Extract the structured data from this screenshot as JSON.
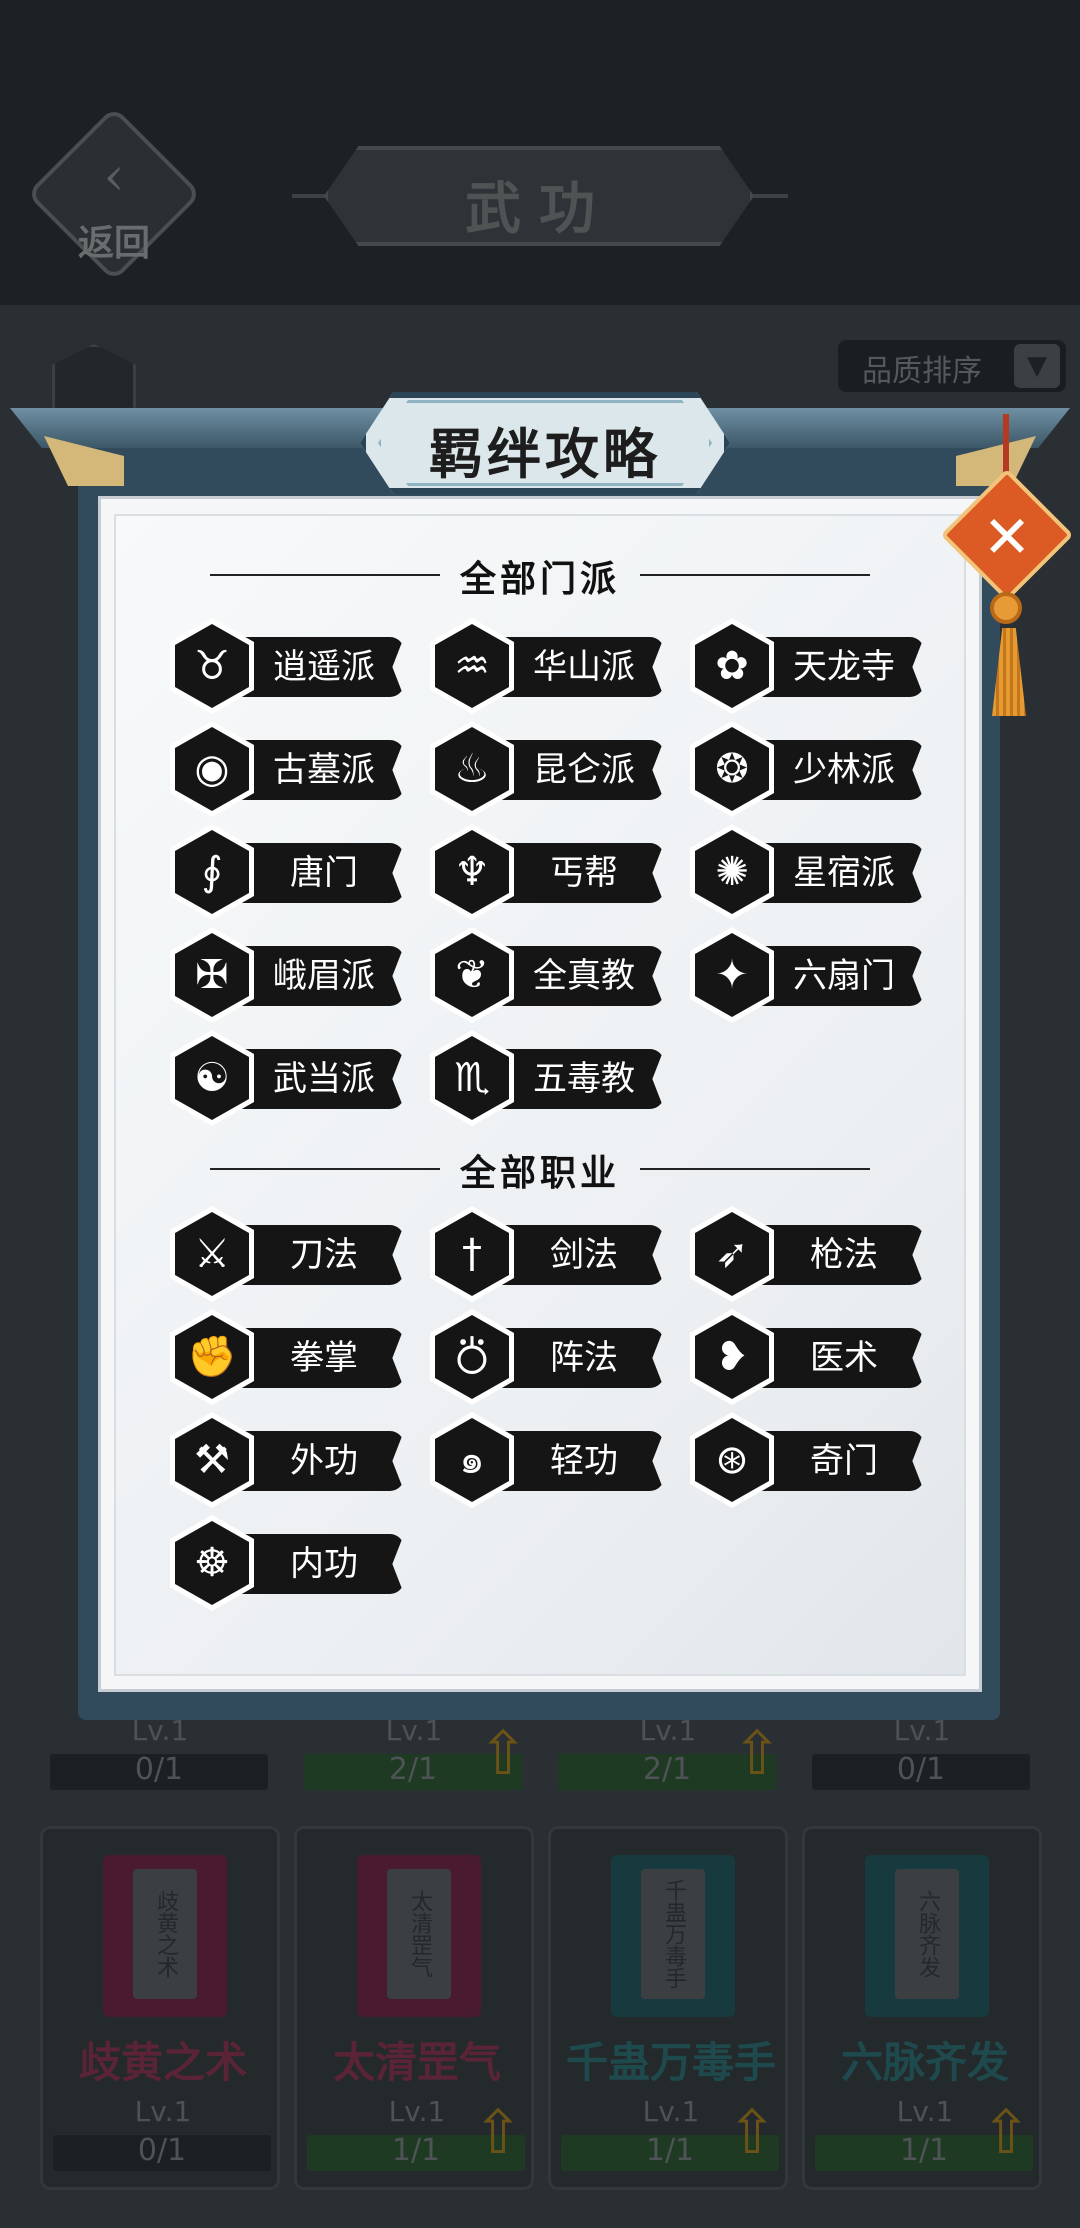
{
  "header": {
    "back_label": "返回",
    "title": "武功"
  },
  "sort": {
    "label": "品质排序"
  },
  "bg_cards": [
    {
      "name": "歧黄之术",
      "seal": "歧黄之术",
      "lv": "Lv.1",
      "progress": "0/1",
      "color": "#5a2436",
      "book": "#4a1b2e"
    },
    {
      "name": "太清罡气",
      "seal": "太清罡气",
      "lv": "Lv.1",
      "progress": "1/1",
      "color": "#5a2436",
      "book": "#4a1b2e"
    },
    {
      "name": "千蛊万毒手",
      "seal": "千蛊万毒手",
      "lv": "Lv.1",
      "progress": "1/1",
      "color": "#1f4a4d",
      "book": "#163a3d"
    },
    {
      "name": "六脉齐发",
      "seal": "六脉齐发",
      "lv": "Lv.1",
      "progress": "1/1",
      "color": "#1f4a4d",
      "book": "#163a3d"
    }
  ],
  "bg_row2": [
    {
      "lv": "Lv.1",
      "progress": "0/1"
    },
    {
      "lv": "Lv.1",
      "progress": "2/1"
    },
    {
      "lv": "Lv.1",
      "progress": "2/1"
    },
    {
      "lv": "Lv.1",
      "progress": "0/1"
    }
  ],
  "modal": {
    "title": "羁绊攻略",
    "close_icon": "close-x-icon",
    "sections": {
      "sects_title": "全部门派",
      "jobs_title": "全部职业"
    },
    "sects": [
      {
        "label": "逍遥派",
        "icon": "gourd-icon",
        "glyph": "♉"
      },
      {
        "label": "华山派",
        "icon": "dragon-wave-icon",
        "glyph": "♒"
      },
      {
        "label": "天龙寺",
        "icon": "lotus-icon",
        "glyph": "✿"
      },
      {
        "label": "古墓派",
        "icon": "eye-icon",
        "glyph": "◉"
      },
      {
        "label": "昆仑派",
        "icon": "flame-mask-icon",
        "glyph": "♨"
      },
      {
        "label": "少林派",
        "icon": "prayer-beads-icon",
        "glyph": "❂"
      },
      {
        "label": "唐门",
        "icon": "phoenix-icon",
        "glyph": "∮"
      },
      {
        "label": "丐帮",
        "icon": "claw-icon",
        "glyph": "♆"
      },
      {
        "label": "星宿派",
        "icon": "star-swirl-icon",
        "glyph": "✺"
      },
      {
        "label": "峨眉派",
        "icon": "sword-cross-icon",
        "glyph": "✠"
      },
      {
        "label": "全真教",
        "icon": "wing-icon",
        "glyph": "❦"
      },
      {
        "label": "六扇门",
        "icon": "compass-star-icon",
        "glyph": "✦"
      },
      {
        "label": "武当派",
        "icon": "yin-yang-icon",
        "glyph": "☯"
      },
      {
        "label": "五毒教",
        "icon": "scorpion-icon",
        "glyph": "♏"
      }
    ],
    "jobs": [
      {
        "label": "刀法",
        "icon": "crossed-blades-icon",
        "glyph": "⚔"
      },
      {
        "label": "剑法",
        "icon": "sword-icon",
        "glyph": "†"
      },
      {
        "label": "枪法",
        "icon": "spear-icon",
        "glyph": "➶"
      },
      {
        "label": "拳掌",
        "icon": "fist-icon",
        "glyph": "✊"
      },
      {
        "label": "阵法",
        "icon": "triquetra-icon",
        "glyph": "⛣"
      },
      {
        "label": "医术",
        "icon": "heart-herb-icon",
        "glyph": "❥"
      },
      {
        "label": "外功",
        "icon": "axe-icon",
        "glyph": "⚒"
      },
      {
        "label": "轻功",
        "icon": "swirl-wind-icon",
        "glyph": "๑"
      },
      {
        "label": "奇门",
        "icon": "orb-icon",
        "glyph": "⊛"
      },
      {
        "label": "内功",
        "icon": "meditation-icon",
        "glyph": "☸"
      }
    ]
  }
}
